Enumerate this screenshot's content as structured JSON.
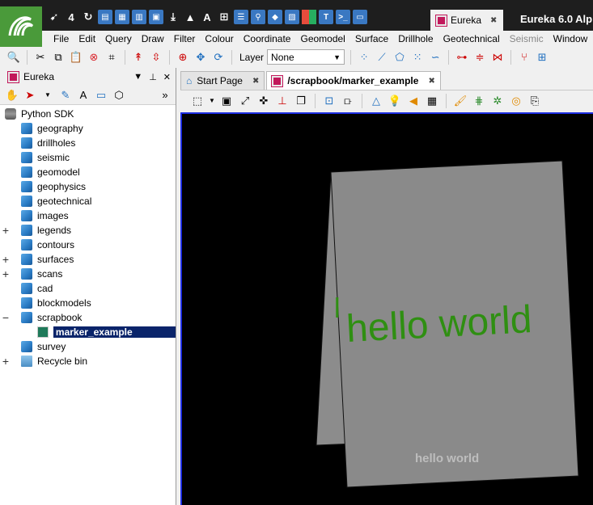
{
  "window": {
    "title": "Eureka 6.0 Alp",
    "doc_tab": "Eureka"
  },
  "menu": [
    "File",
    "Edit",
    "Query",
    "Draw",
    "Filter",
    "Colour",
    "Coordinate",
    "Geomodel",
    "Surface",
    "Drillhole",
    "Geotechnical",
    "Seismic",
    "Window"
  ],
  "toolbar": {
    "layer_label": "Layer",
    "layer_value": "None"
  },
  "panel": {
    "title": "Eureka",
    "tree_root": "Python SDK",
    "items": [
      {
        "label": "geography",
        "expandable": false
      },
      {
        "label": "drillholes",
        "expandable": false
      },
      {
        "label": "seismic",
        "expandable": false
      },
      {
        "label": "geomodel",
        "expandable": false
      },
      {
        "label": "geophysics",
        "expandable": false
      },
      {
        "label": "geotechnical",
        "expandable": false
      },
      {
        "label": "images",
        "expandable": false
      },
      {
        "label": "legends",
        "expandable": true
      },
      {
        "label": "contours",
        "expandable": false
      },
      {
        "label": "surfaces",
        "expandable": true
      },
      {
        "label": "scans",
        "expandable": true
      },
      {
        "label": "cad",
        "expandable": false
      },
      {
        "label": "blockmodels",
        "expandable": false
      },
      {
        "label": "scrapbook",
        "expandable": true,
        "expanded": true
      }
    ],
    "selected_child": "marker_example",
    "after": [
      {
        "label": "survey",
        "expandable": false
      },
      {
        "label": "Recycle bin",
        "expandable": true
      }
    ]
  },
  "tabs": [
    {
      "label": "Start Page",
      "active": false
    },
    {
      "label": "/scrapbook/marker_example",
      "active": true
    }
  ],
  "viewport": {
    "text_large": "hello world",
    "text_small": "hello world",
    "text_color": "#2f8f12",
    "panel_color": "#8a8a8a"
  },
  "colors": {
    "selection": "#0a246a",
    "viewport_border": "#1d2de0",
    "logo": "#4a9a3a"
  }
}
